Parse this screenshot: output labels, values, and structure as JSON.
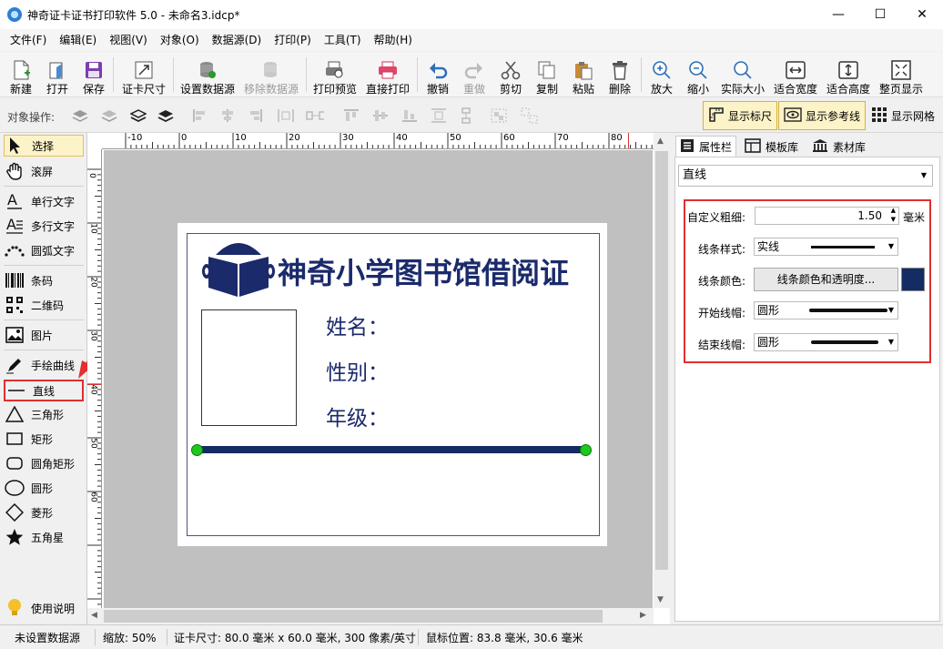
{
  "window": {
    "title": "神奇证卡证书打印软件 5.0 - 未命名3.idcp*",
    "min": "—",
    "max": "☐",
    "close": "✕"
  },
  "menu": [
    "文件(F)",
    "编辑(E)",
    "视图(V)",
    "对象(O)",
    "数据源(D)",
    "打印(P)",
    "工具(T)",
    "帮助(H)"
  ],
  "toolbar": {
    "new": "新建",
    "open": "打开",
    "save": "保存",
    "card_size": "证卡尺寸",
    "set_datasource": "设置数据源",
    "remove_datasource": "移除数据源",
    "print_preview": "打印预览",
    "direct_print": "直接打印",
    "undo": "撤销",
    "redo": "重做",
    "cut": "剪切",
    "copy": "复制",
    "paste": "粘贴",
    "delete": "删除",
    "zoom_in": "放大",
    "zoom_out": "缩小",
    "actual_size": "实际大小",
    "fit_width": "适合宽度",
    "fit_height": "适合高度",
    "whole_page": "整页显示"
  },
  "objbar": {
    "label": "对象操作:",
    "show_ruler": "显示标尺",
    "show_guides": "显示参考线",
    "show_grid": "显示网格"
  },
  "tools": [
    "选择",
    "滚屏",
    "单行文字",
    "多行文字",
    "圆弧文字",
    "条码",
    "二维码",
    "图片",
    "手绘曲线",
    "直线",
    "三角形",
    "矩形",
    "圆角矩形",
    "圆形",
    "菱形",
    "五角星",
    "使用说明"
  ],
  "ruler": {
    "h": [
      "-10",
      "0",
      "10",
      "20",
      "30",
      "40",
      "50",
      "60",
      "70",
      "80"
    ],
    "v": [
      "0",
      "10",
      "20",
      "30",
      "40",
      "50",
      "60"
    ]
  },
  "card": {
    "title": "神奇小学图书馆借阅证",
    "name": "姓名：",
    "gender": "性别：",
    "grade": "年级："
  },
  "panel": {
    "tabs": [
      "属性栏",
      "模板库",
      "素材库"
    ],
    "object": "直线",
    "thickness_label": "自定义粗细:",
    "thickness_value": "1.50",
    "thickness_unit": "毫米",
    "style_label": "线条样式:",
    "style_value": "实线",
    "color_label": "线条颜色:",
    "color_button": "线条颜色和透明度...",
    "color_value": "#142b63",
    "start_cap_label": "开始线帽:",
    "start_cap_value": "圆形",
    "end_cap_label": "结束线帽:",
    "end_cap_value": "圆形"
  },
  "status": {
    "datasource": "未设置数据源",
    "zoom": "缩放: 50%",
    "card_size": "证卡尺寸: 80.0 毫米 x 60.0 毫米, 300 像素/英寸",
    "mouse": "鼠标位置: 83.8 毫米, 30.6 毫米"
  },
  "colors": {
    "accent_red": "#e03030",
    "navy": "#1a2a6b",
    "handle_green": "#1ec71e"
  }
}
